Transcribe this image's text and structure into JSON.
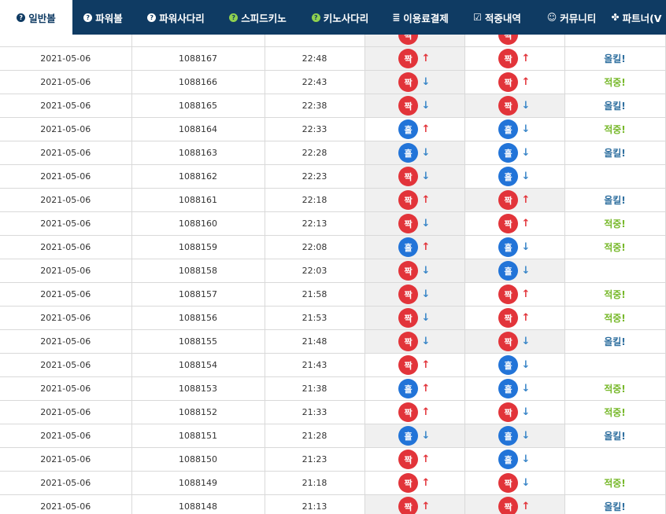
{
  "nav": {
    "tabs": [
      {
        "label": "일반볼",
        "icon": "question-circle-icon",
        "active": true,
        "green": false
      },
      {
        "label": "파워볼",
        "icon": "question-circle-icon",
        "active": false,
        "green": false
      },
      {
        "label": "파워사다리",
        "icon": "question-circle-icon",
        "active": false,
        "green": false
      },
      {
        "label": "스피드키노",
        "icon": "question-circle-icon",
        "active": false,
        "green": true
      },
      {
        "label": "키노사다리",
        "icon": "question-circle-icon",
        "active": false,
        "green": true
      },
      {
        "label": "이용료결제",
        "icon": "database-icon",
        "active": false,
        "green": false
      },
      {
        "label": "적중내역",
        "icon": "checkbox-icon",
        "active": false,
        "green": false
      },
      {
        "label": "커뮤니티",
        "icon": "smiley-icon",
        "active": false,
        "green": false
      },
      {
        "label": "파트너(V",
        "icon": "users-icon",
        "active": false,
        "green": false
      }
    ]
  },
  "colors": {
    "nav_bg": "#0f3b63",
    "ball_red": "#e2343a",
    "ball_blue": "#2274d8",
    "hit_text": "#77b82a",
    "miss_text": "#2f6f9f",
    "shade": "#f0f0f0"
  },
  "labels": {
    "odd": "홀",
    "even": "짝",
    "up": "↑",
    "down": "↓"
  },
  "rows": [
    {
      "date": "",
      "round": "",
      "time": "",
      "a": {
        "ball": "even",
        "arrow": ""
      },
      "b": {
        "ball": "even",
        "arrow": ""
      },
      "result": "",
      "shade": "a"
    },
    {
      "date": "2021-05-06",
      "round": "1088167",
      "time": "22:48",
      "a": {
        "ball": "even",
        "arrow": "up"
      },
      "b": {
        "ball": "even",
        "arrow": "up"
      },
      "result": "올킬!",
      "shade": "a"
    },
    {
      "date": "2021-05-06",
      "round": "1088166",
      "time": "22:43",
      "a": {
        "ball": "even",
        "arrow": "down"
      },
      "b": {
        "ball": "even",
        "arrow": "up"
      },
      "result": "적중!",
      "shade": "a"
    },
    {
      "date": "2021-05-06",
      "round": "1088165",
      "time": "22:38",
      "a": {
        "ball": "even",
        "arrow": "down"
      },
      "b": {
        "ball": "even",
        "arrow": "down"
      },
      "result": "올킬!",
      "shade": "ab"
    },
    {
      "date": "2021-05-06",
      "round": "1088164",
      "time": "22:33",
      "a": {
        "ball": "odd",
        "arrow": "up"
      },
      "b": {
        "ball": "odd",
        "arrow": "down"
      },
      "result": "적중!",
      "shade": ""
    },
    {
      "date": "2021-05-06",
      "round": "1088163",
      "time": "22:28",
      "a": {
        "ball": "odd",
        "arrow": "down"
      },
      "b": {
        "ball": "odd",
        "arrow": "down"
      },
      "result": "올킬!",
      "shade": "a"
    },
    {
      "date": "2021-05-06",
      "round": "1088162",
      "time": "22:23",
      "a": {
        "ball": "even",
        "arrow": "down"
      },
      "b": {
        "ball": "odd",
        "arrow": "down"
      },
      "result": "",
      "shade": "a"
    },
    {
      "date": "2021-05-06",
      "round": "1088161",
      "time": "22:18",
      "a": {
        "ball": "even",
        "arrow": "up"
      },
      "b": {
        "ball": "even",
        "arrow": "up"
      },
      "result": "올킬!",
      "shade": "ab"
    },
    {
      "date": "2021-05-06",
      "round": "1088160",
      "time": "22:13",
      "a": {
        "ball": "even",
        "arrow": "down"
      },
      "b": {
        "ball": "even",
        "arrow": "up"
      },
      "result": "적중!",
      "shade": "a"
    },
    {
      "date": "2021-05-06",
      "round": "1088159",
      "time": "22:08",
      "a": {
        "ball": "odd",
        "arrow": "up"
      },
      "b": {
        "ball": "odd",
        "arrow": "down"
      },
      "result": "적중!",
      "shade": "a"
    },
    {
      "date": "2021-05-06",
      "round": "1088158",
      "time": "22:03",
      "a": {
        "ball": "even",
        "arrow": "down"
      },
      "b": {
        "ball": "odd",
        "arrow": "down"
      },
      "result": "",
      "shade": "ab"
    },
    {
      "date": "2021-05-06",
      "round": "1088157",
      "time": "21:58",
      "a": {
        "ball": "even",
        "arrow": "down"
      },
      "b": {
        "ball": "even",
        "arrow": "up"
      },
      "result": "적중!",
      "shade": "a"
    },
    {
      "date": "2021-05-06",
      "round": "1088156",
      "time": "21:53",
      "a": {
        "ball": "even",
        "arrow": "down"
      },
      "b": {
        "ball": "even",
        "arrow": "up"
      },
      "result": "적중!",
      "shade": "a"
    },
    {
      "date": "2021-05-06",
      "round": "1088155",
      "time": "21:48",
      "a": {
        "ball": "even",
        "arrow": "down"
      },
      "b": {
        "ball": "even",
        "arrow": "down"
      },
      "result": "올킬!",
      "shade": "ab"
    },
    {
      "date": "2021-05-06",
      "round": "1088154",
      "time": "21:43",
      "a": {
        "ball": "even",
        "arrow": "up"
      },
      "b": {
        "ball": "odd",
        "arrow": "down"
      },
      "result": "",
      "shade": ""
    },
    {
      "date": "2021-05-06",
      "round": "1088153",
      "time": "21:38",
      "a": {
        "ball": "odd",
        "arrow": "up"
      },
      "b": {
        "ball": "odd",
        "arrow": "down"
      },
      "result": "적중!",
      "shade": ""
    },
    {
      "date": "2021-05-06",
      "round": "1088152",
      "time": "21:33",
      "a": {
        "ball": "even",
        "arrow": "up"
      },
      "b": {
        "ball": "even",
        "arrow": "down"
      },
      "result": "적중!",
      "shade": ""
    },
    {
      "date": "2021-05-06",
      "round": "1088151",
      "time": "21:28",
      "a": {
        "ball": "odd",
        "arrow": "down"
      },
      "b": {
        "ball": "odd",
        "arrow": "down"
      },
      "result": "올킬!",
      "shade": "ab"
    },
    {
      "date": "2021-05-06",
      "round": "1088150",
      "time": "21:23",
      "a": {
        "ball": "even",
        "arrow": "up"
      },
      "b": {
        "ball": "odd",
        "arrow": "down"
      },
      "result": "",
      "shade": ""
    },
    {
      "date": "2021-05-06",
      "round": "1088149",
      "time": "21:18",
      "a": {
        "ball": "even",
        "arrow": "up"
      },
      "b": {
        "ball": "even",
        "arrow": "down"
      },
      "result": "적중!",
      "shade": ""
    },
    {
      "date": "2021-05-06",
      "round": "1088148",
      "time": "21:13",
      "a": {
        "ball": "even",
        "arrow": "up"
      },
      "b": {
        "ball": "even",
        "arrow": "up"
      },
      "result": "올킬!",
      "shade": "ab"
    }
  ]
}
